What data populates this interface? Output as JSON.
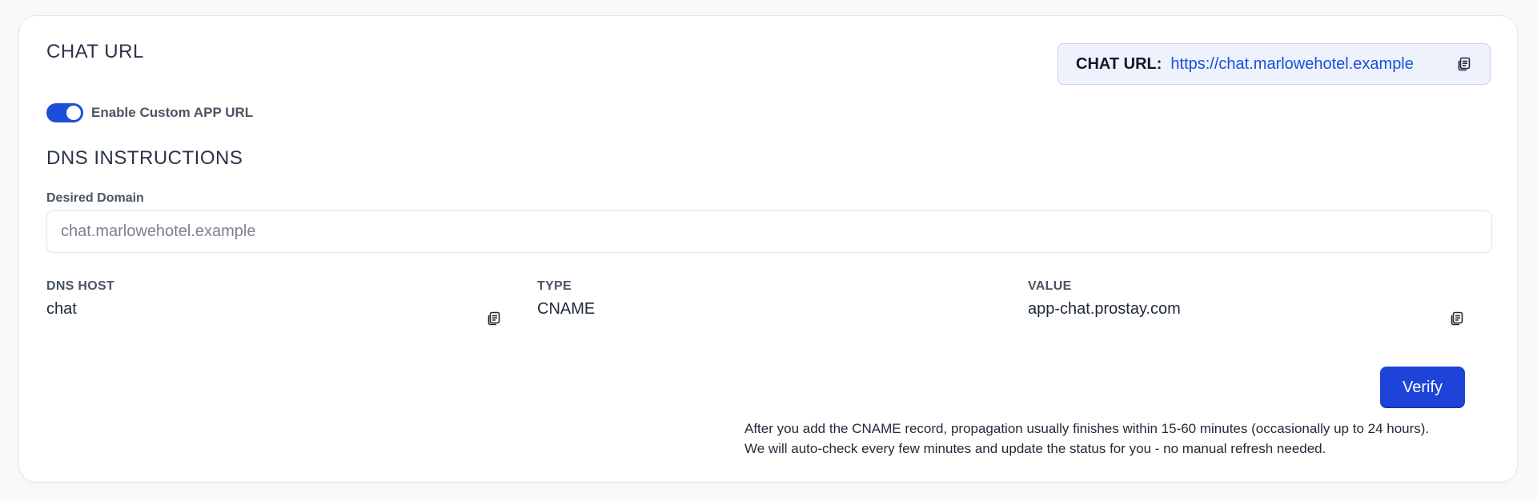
{
  "chat_url_section": {
    "title": "CHAT URL",
    "pill_label": "CHAT URL:",
    "pill_url": "https://chat.marlowehotel.example",
    "copy_icon": "copy-icon"
  },
  "toggle": {
    "label": "Enable Custom APP URL",
    "checked": true,
    "color": "#1d4ed8"
  },
  "dns_section": {
    "title": "DNS INSTRUCTIONS",
    "desired_domain_label": "Desired Domain",
    "desired_domain_placeholder": "chat.marlowehotel.example",
    "columns": [
      {
        "header": "DNS HOST",
        "value": "chat"
      },
      {
        "header": "TYPE",
        "value": "CNAME"
      },
      {
        "header": "VALUE",
        "value": "app-chat.prostay.com"
      }
    ]
  },
  "verify_button": {
    "label": "Verify",
    "color": "#1d43d8"
  },
  "note": {
    "line1": "After you add the CNAME record, propagation usually finishes within 15-60 minutes (occasionally up to 24 hours).",
    "line2": "We will auto-check every few minutes and update the status for you - no manual refresh needed."
  }
}
